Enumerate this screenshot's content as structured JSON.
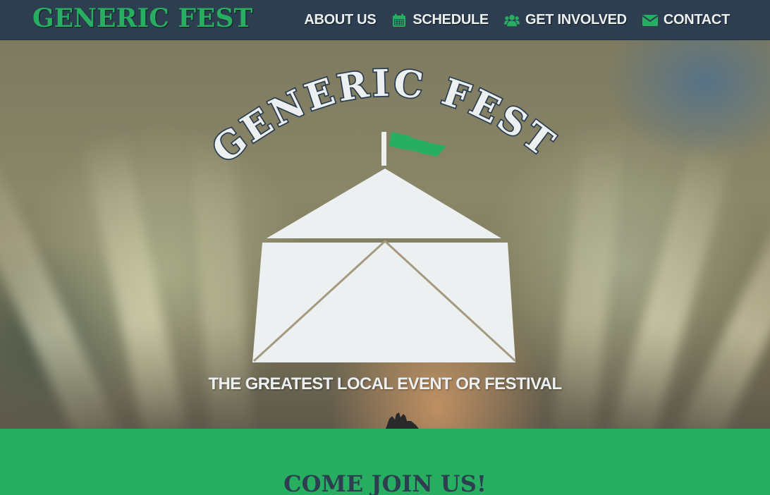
{
  "brand": "GENERIC FEST",
  "nav": {
    "items": [
      {
        "label": "ABOUT US",
        "icon": null
      },
      {
        "label": "SCHEDULE",
        "icon": "calendar-icon"
      },
      {
        "label": "GET INVOLVED",
        "icon": "users-icon"
      },
      {
        "label": "CONTACT",
        "icon": "envelope-icon"
      }
    ]
  },
  "hero": {
    "logo_text": "GENERIC FEST",
    "tagline": "THE GREATEST LOCAL EVENT OR FESTIVAL"
  },
  "join": {
    "title": "COME JOIN US!"
  },
  "colors": {
    "navbar": "#2c3e50",
    "accent_green": "#27ae60",
    "light": "#ecf0f1",
    "dark_navy": "#2c3e50"
  }
}
